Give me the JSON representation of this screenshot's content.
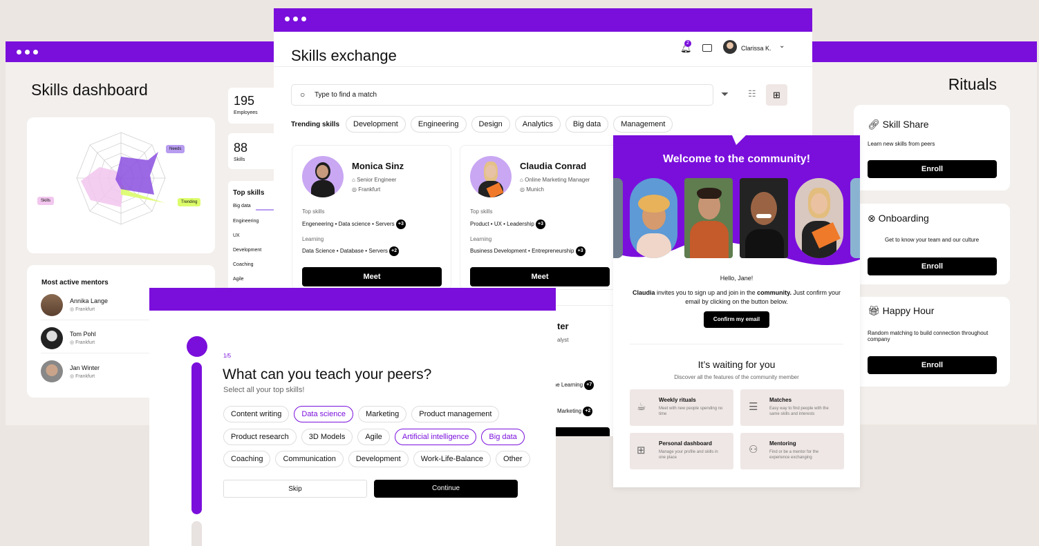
{
  "dashboard": {
    "title": "Skills dashboard",
    "stats": [
      {
        "value": "195",
        "label": "Employees"
      },
      {
        "value": "88",
        "label": "Skills"
      }
    ],
    "radar": {
      "labels": {
        "needs": "Needs",
        "trending": "Trending",
        "skills": "Skills"
      }
    },
    "top_skills": {
      "title": "Top skills",
      "items": [
        "Big data",
        "Engineering",
        "UX",
        "Development",
        "Coaching",
        "Agile"
      ]
    },
    "mentors": {
      "title": "Most active mentors",
      "items": [
        {
          "name": "Annika Lange",
          "location": "Frankfurt"
        },
        {
          "name": "Tom Pohl",
          "location": "Frankfurt"
        },
        {
          "name": "Jan Winter",
          "location": "Frankfurt"
        }
      ]
    }
  },
  "exchange": {
    "title": "Skills exchange",
    "notification_count": "2",
    "user": "Clarissa K.",
    "search_placeholder": "Type to find a match",
    "trending_label": "Trending skills",
    "trending": [
      "Development",
      "Engineering",
      "Design",
      "Analytics",
      "Big data",
      "Management"
    ],
    "profiles": [
      {
        "name": "Monica Sinz",
        "role": "Senior Engineer",
        "location": "Frankfurt",
        "top_label": "Top skills",
        "top": "Engeneering  •  Data science  •  Servers",
        "top_more": "+3",
        "learn_label": "Learning",
        "learn": "Data Science  •  Database  •  Servers",
        "learn_more": "+2",
        "button": "Meet"
      },
      {
        "name": "Claudia Conrad",
        "role": "Online Marketing Manager",
        "location": "Munich",
        "top_label": "Top skills",
        "top": "Product  •  UX  •  Leadership",
        "top_more": "+3",
        "learn_label": "Learning",
        "learn": "Business Development  •  Entrepreneurship",
        "learn_more": "+3",
        "button": "Meet"
      }
    ],
    "partial": {
      "name": "ter",
      "role": "alyst",
      "learn": "ine Learning",
      "learn_more": "+7",
      "learn2": "Marketing",
      "learn2_more": "+2"
    }
  },
  "welcome": {
    "title": "Welcome to the community!",
    "greeting": "Hello, Jane!",
    "invite_name": "Claudia",
    "invite_text_1": " invites you to sign up and join in the ",
    "invite_bold": "community.",
    "invite_text_2": " Just confirm your email by clicking on the button below.",
    "confirm_button": "Confirm my email",
    "waiting_title": "It’s waiting for you",
    "waiting_sub": "Discover all the features of the community member",
    "features": [
      {
        "title": "Weekly rituals",
        "desc": "Meet with new people spending no time",
        "icon": "coffee-icon"
      },
      {
        "title": "Matches",
        "desc": "Easy way to find people with the same skills and interests",
        "icon": "lines-icon"
      },
      {
        "title": "Personal dashboard",
        "desc": "Manage your profile and skills in one place",
        "icon": "dashboard-icon"
      },
      {
        "title": "Mentoring",
        "desc": "Find or be a mentor for the experience exchanging",
        "icon": "people-icon"
      }
    ]
  },
  "rituals": {
    "title": "Rituals",
    "items": [
      {
        "title": "Skill Share",
        "desc": "Learn new skills from peers",
        "button": "Enroll",
        "icon": "link-icon"
      },
      {
        "title": "Onboarding",
        "desc": "Get to know your team and our culture",
        "button": "Enroll",
        "icon": "compass-icon"
      },
      {
        "title": "Happy Hour",
        "desc": "Random matching to build connection throughout company",
        "button": "Enroll",
        "icon": "gift-icon"
      }
    ]
  },
  "onboarding": {
    "step": "1/5",
    "question": "What can you teach your peers?",
    "sub": "Select all your top skills!",
    "chips": [
      {
        "label": "Content writing",
        "selected": false
      },
      {
        "label": "Data science",
        "selected": true
      },
      {
        "label": "Marketing",
        "selected": false
      },
      {
        "label": "Product management",
        "selected": false
      },
      {
        "label": "Product research",
        "selected": false
      },
      {
        "label": "3D Models",
        "selected": false
      },
      {
        "label": "Agile",
        "selected": false
      },
      {
        "label": "Artificial intelligence",
        "selected": true
      },
      {
        "label": "Big data",
        "selected": true
      },
      {
        "label": "Coaching",
        "selected": false
      },
      {
        "label": "Communication",
        "selected": false
      },
      {
        "label": "Development",
        "selected": false
      },
      {
        "label": "Work-Life-Balance",
        "selected": false
      },
      {
        "label": "Other",
        "selected": false
      }
    ],
    "skip": "Skip",
    "continue": "Continue"
  },
  "colors": {
    "accent": "#7a0fdc",
    "background": "#ece6e2",
    "card": "#ffffff",
    "lavender": "#b79cf0",
    "pink": "#f2c6ee",
    "lime": "#dcfc6a"
  }
}
